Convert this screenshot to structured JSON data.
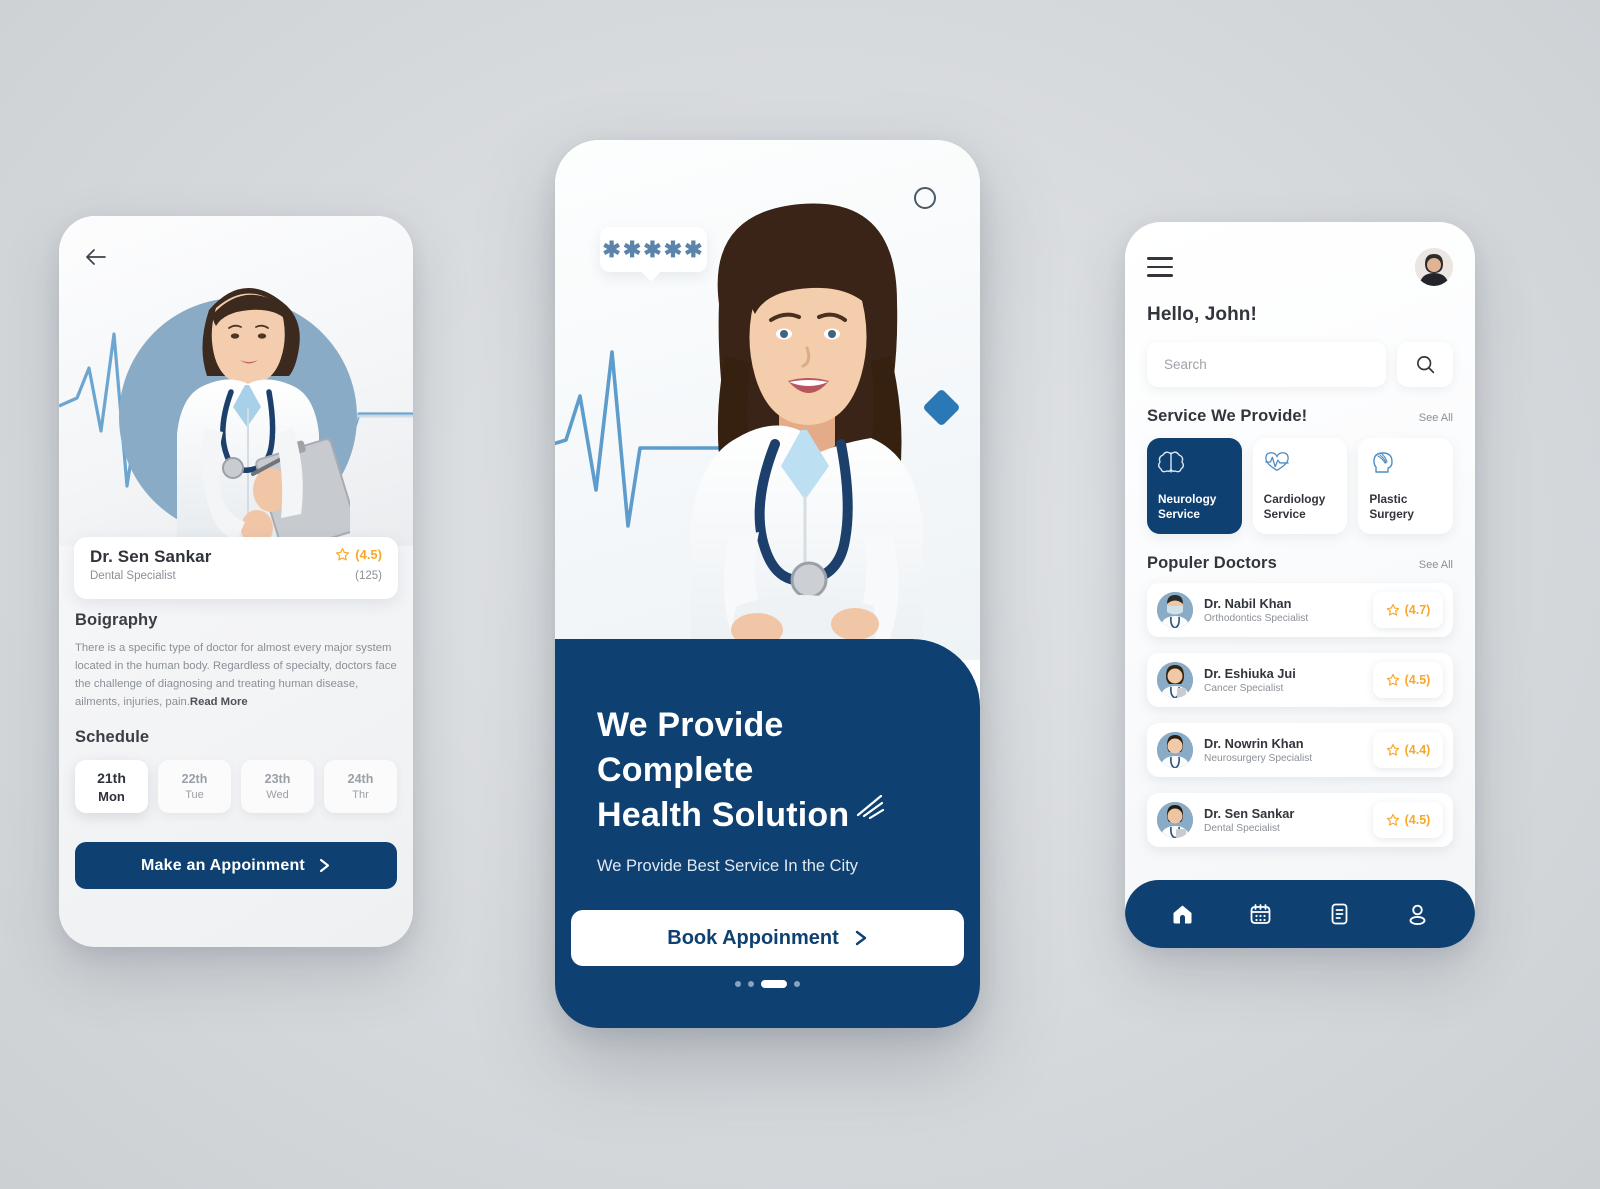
{
  "colors": {
    "primary": "#0e4071",
    "accent_star": "#f7a82b",
    "page_bg": "#d9dcdf",
    "circle_blue": "#8aabc6",
    "diamond_blue": "#2a78b5"
  },
  "phone_detail": {
    "back_icon": "arrow-left-icon",
    "doctor": {
      "name": "Dr. Sen Sankar",
      "specialty": "Dental Specialist",
      "rating": "(4.5)",
      "review_count": "(125)"
    },
    "biography": {
      "heading": "Boigraphy",
      "text": "There is a specific type of doctor for almost every major system located in the human body. Regardless of specialty, doctors face the challenge of diagnosing and treating human disease, ailments, injuries, pain.",
      "read_more": "Read More"
    },
    "schedule": {
      "heading": "Schedule",
      "days": [
        {
          "num": "21th",
          "dow": "Mon",
          "selected": true
        },
        {
          "num": "22th",
          "dow": "Tue",
          "selected": false
        },
        {
          "num": "23th",
          "dow": "Wed",
          "selected": false
        },
        {
          "num": "24th",
          "dow": "Thr",
          "selected": false
        }
      ]
    },
    "cta": "Make an Appoinment"
  },
  "phone_onboarding": {
    "stars_badge": "✱✱✱✱✱",
    "ring_icon": "circle-outline-icon",
    "diamond_icon": "diamond-icon",
    "headline_line1": "We Provide Complete",
    "headline_line2": "Health Solution",
    "subhead": "We Provide Best Service In the City",
    "cta": "Book Appoinment",
    "pager": {
      "total": 4,
      "active_index": 2
    }
  },
  "phone_home": {
    "menu_icon": "hamburger-menu-icon",
    "avatar_icon": "user-avatar",
    "greeting": "Hello, John!",
    "search": {
      "placeholder": "Search",
      "value": "",
      "button_icon": "search-icon"
    },
    "services": {
      "heading": "Service We Provide!",
      "see_all": "See All",
      "items": [
        {
          "label_line1": "Neurology",
          "label_line2": "Service",
          "icon": "brain-icon",
          "active": true
        },
        {
          "label_line1": "Cardiology",
          "label_line2": "Service",
          "icon": "heart-pulse-icon",
          "active": false
        },
        {
          "label_line1": "Plastic",
          "label_line2": "Surgery",
          "icon": "face-profile-icon",
          "active": false
        }
      ]
    },
    "doctors": {
      "heading": "Populer Doctors",
      "see_all": "See All",
      "items": [
        {
          "name": "Dr. Nabil Khan",
          "specialty": "Orthodontics Specialist",
          "rating": "(4.7)"
        },
        {
          "name": "Dr. Eshiuka Jui",
          "specialty": "Cancer Specialist",
          "rating": "(4.5)"
        },
        {
          "name": "Dr. Nowrin Khan",
          "specialty": "Neurosurgery Specialist",
          "rating": "(4.4)"
        },
        {
          "name": "Dr. Sen Sankar",
          "specialty": "Dental Specialist",
          "rating": "(4.5)"
        }
      ]
    },
    "tabbar": [
      {
        "icon": "home-icon",
        "active": true
      },
      {
        "icon": "calendar-icon",
        "active": false
      },
      {
        "icon": "document-icon",
        "active": false
      },
      {
        "icon": "person-icon",
        "active": false
      }
    ]
  }
}
